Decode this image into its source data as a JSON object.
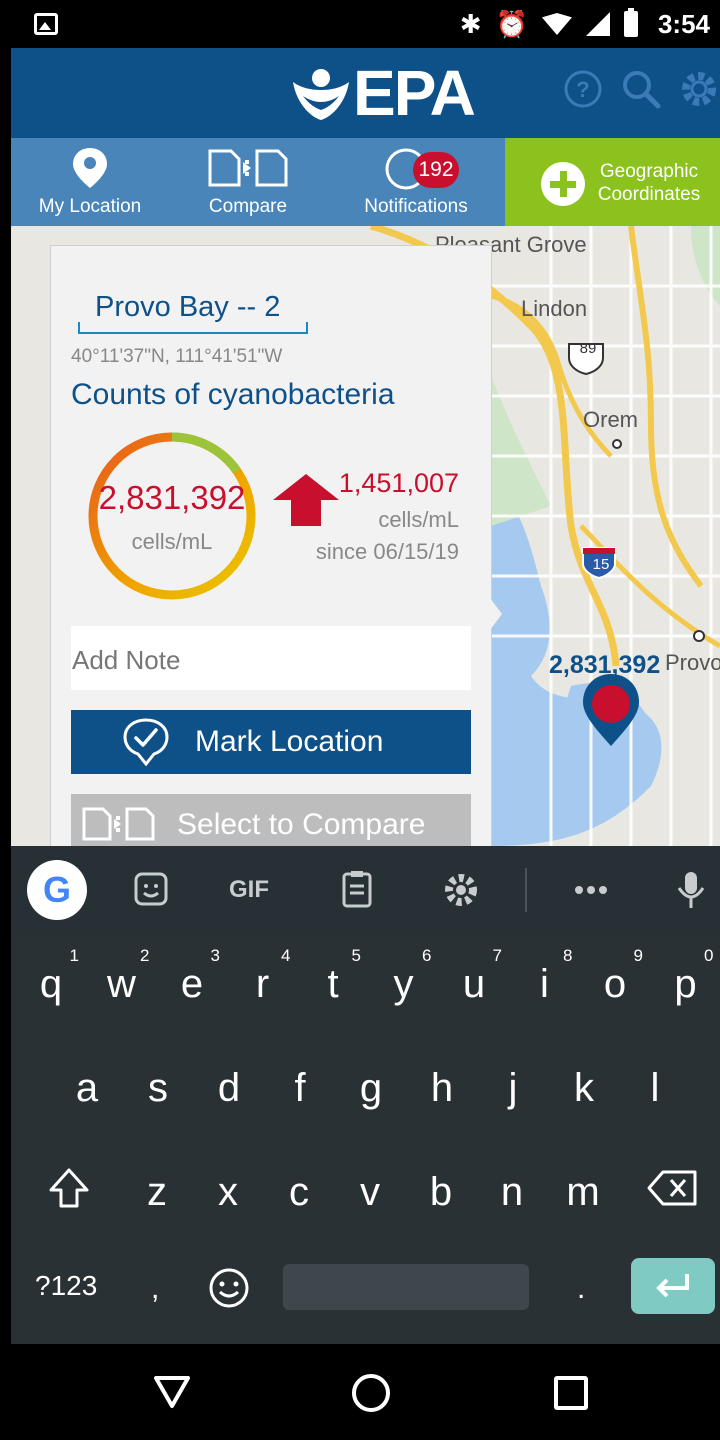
{
  "status_bar": {
    "time": "3:54"
  },
  "header": {
    "logo_text": "EPA"
  },
  "tabs": {
    "my_location": "My Location",
    "compare": "Compare",
    "notifications": "Notifications",
    "notifications_badge": "192",
    "geographic_line1": "Geographic",
    "geographic_line2": "Coordinates"
  },
  "map": {
    "labels": {
      "pleasant_grove": "Pleasant Grove",
      "lindon": "Lindon",
      "orem": "Orem",
      "provo": "Provo",
      "route_89": "89",
      "route_15": "15"
    },
    "marker_count": "2,831,392"
  },
  "card": {
    "name_value": "Provo Bay -- 2",
    "coords": "40°11'37\"N, 111°41'51\"W",
    "title": "Counts of cyanobacteria",
    "count_value": "2,831,392",
    "count_unit": "cells/mL",
    "delta_value": "1,451,007",
    "delta_unit": "cells/mL",
    "delta_since": "since 06/15/19",
    "note_placeholder": "Add Note",
    "mark_label": "Mark Location",
    "compare_label": "Select to Compare"
  },
  "keyboard": {
    "gif_label": "GIF",
    "row1": [
      {
        "k": "q",
        "n": "1"
      },
      {
        "k": "w",
        "n": "2"
      },
      {
        "k": "e",
        "n": "3"
      },
      {
        "k": "r",
        "n": "4"
      },
      {
        "k": "t",
        "n": "5"
      },
      {
        "k": "y",
        "n": "6"
      },
      {
        "k": "u",
        "n": "7"
      },
      {
        "k": "i",
        "n": "8"
      },
      {
        "k": "o",
        "n": "9"
      },
      {
        "k": "p",
        "n": "0"
      }
    ],
    "row2": [
      "a",
      "s",
      "d",
      "f",
      "g",
      "h",
      "j",
      "k",
      "l"
    ],
    "row3": [
      "z",
      "x",
      "c",
      "v",
      "b",
      "n",
      "m"
    ],
    "symbols_label": "?123",
    "comma": ",",
    "period": "."
  },
  "colors": {
    "epa_blue": "#0e5189",
    "tab_blue": "#4a85b9",
    "accent_green": "#8cc21e",
    "alert_red": "#c8102e"
  }
}
